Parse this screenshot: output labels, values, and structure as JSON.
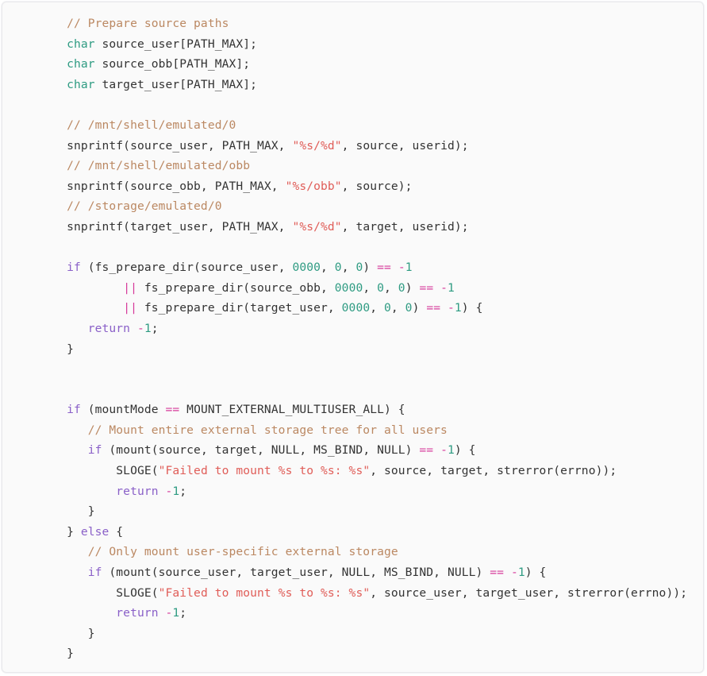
{
  "code_block": {
    "language": "c",
    "theme": {
      "background": "#fafafa",
      "border": "#e9e9ec",
      "plain": "#333333",
      "comment": "#bb8862",
      "type_keyword": "#2e9b82",
      "control_keyword": "#8a60c8",
      "string": "#e05d58",
      "number": "#2e9b82",
      "operator": "#d6399a"
    },
    "lines": [
      {
        "id": 1,
        "indent": 8,
        "tokens": [
          {
            "t": "com",
            "v": "// Prepare source paths"
          }
        ]
      },
      {
        "id": 2,
        "indent": 8,
        "tokens": [
          {
            "t": "typ",
            "v": "char"
          },
          {
            "t": "pln",
            "v": " source_user[PATH_MAX];"
          }
        ]
      },
      {
        "id": 3,
        "indent": 8,
        "tokens": [
          {
            "t": "typ",
            "v": "char"
          },
          {
            "t": "pln",
            "v": " source_obb[PATH_MAX];"
          }
        ]
      },
      {
        "id": 4,
        "indent": 8,
        "tokens": [
          {
            "t": "typ",
            "v": "char"
          },
          {
            "t": "pln",
            "v": " target_user[PATH_MAX];"
          }
        ]
      },
      {
        "id": 5,
        "indent": 0,
        "tokens": []
      },
      {
        "id": 6,
        "indent": 8,
        "tokens": [
          {
            "t": "com",
            "v": "// /mnt/shell/emulated/0"
          }
        ]
      },
      {
        "id": 7,
        "indent": 8,
        "tokens": [
          {
            "t": "pln",
            "v": "snprintf(source_user, PATH_MAX, "
          },
          {
            "t": "str",
            "v": "\"%s/%d\""
          },
          {
            "t": "pln",
            "v": ", source, userid);"
          }
        ]
      },
      {
        "id": 8,
        "indent": 8,
        "tokens": [
          {
            "t": "com",
            "v": "// /mnt/shell/emulated/obb"
          }
        ]
      },
      {
        "id": 9,
        "indent": 8,
        "tokens": [
          {
            "t": "pln",
            "v": "snprintf(source_obb, PATH_MAX, "
          },
          {
            "t": "str",
            "v": "\"%s/obb\""
          },
          {
            "t": "pln",
            "v": ", source);"
          }
        ]
      },
      {
        "id": 10,
        "indent": 8,
        "tokens": [
          {
            "t": "com",
            "v": "// /storage/emulated/0"
          }
        ]
      },
      {
        "id": 11,
        "indent": 8,
        "tokens": [
          {
            "t": "pln",
            "v": "snprintf(target_user, PATH_MAX, "
          },
          {
            "t": "str",
            "v": "\"%s/%d\""
          },
          {
            "t": "pln",
            "v": ", target, userid);"
          }
        ]
      },
      {
        "id": 12,
        "indent": 0,
        "tokens": []
      },
      {
        "id": 13,
        "indent": 8,
        "tokens": [
          {
            "t": "kw",
            "v": "if"
          },
          {
            "t": "pln",
            "v": " (fs_prepare_dir(source_user, "
          },
          {
            "t": "num",
            "v": "0000"
          },
          {
            "t": "pln",
            "v": ", "
          },
          {
            "t": "num",
            "v": "0"
          },
          {
            "t": "pln",
            "v": ", "
          },
          {
            "t": "num",
            "v": "0"
          },
          {
            "t": "pln",
            "v": ") "
          },
          {
            "t": "op",
            "v": "=="
          },
          {
            "t": "pln",
            "v": " "
          },
          {
            "t": "op",
            "v": "-"
          },
          {
            "t": "num",
            "v": "1"
          }
        ]
      },
      {
        "id": 14,
        "indent": 16,
        "tokens": [
          {
            "t": "op",
            "v": "||"
          },
          {
            "t": "pln",
            "v": " fs_prepare_dir(source_obb, "
          },
          {
            "t": "num",
            "v": "0000"
          },
          {
            "t": "pln",
            "v": ", "
          },
          {
            "t": "num",
            "v": "0"
          },
          {
            "t": "pln",
            "v": ", "
          },
          {
            "t": "num",
            "v": "0"
          },
          {
            "t": "pln",
            "v": ") "
          },
          {
            "t": "op",
            "v": "=="
          },
          {
            "t": "pln",
            "v": " "
          },
          {
            "t": "op",
            "v": "-"
          },
          {
            "t": "num",
            "v": "1"
          }
        ]
      },
      {
        "id": 15,
        "indent": 16,
        "tokens": [
          {
            "t": "op",
            "v": "||"
          },
          {
            "t": "pln",
            "v": " fs_prepare_dir(target_user, "
          },
          {
            "t": "num",
            "v": "0000"
          },
          {
            "t": "pln",
            "v": ", "
          },
          {
            "t": "num",
            "v": "0"
          },
          {
            "t": "pln",
            "v": ", "
          },
          {
            "t": "num",
            "v": "0"
          },
          {
            "t": "pln",
            "v": ") "
          },
          {
            "t": "op",
            "v": "=="
          },
          {
            "t": "pln",
            "v": " "
          },
          {
            "t": "op",
            "v": "-"
          },
          {
            "t": "num",
            "v": "1"
          },
          {
            "t": "pln",
            "v": ") {"
          }
        ]
      },
      {
        "id": 16,
        "indent": 11,
        "tokens": [
          {
            "t": "kw",
            "v": "return"
          },
          {
            "t": "pln",
            "v": " "
          },
          {
            "t": "op",
            "v": "-"
          },
          {
            "t": "num",
            "v": "1"
          },
          {
            "t": "pln",
            "v": ";"
          }
        ]
      },
      {
        "id": 17,
        "indent": 8,
        "tokens": [
          {
            "t": "pln",
            "v": "}"
          }
        ]
      },
      {
        "id": 18,
        "indent": 0,
        "tokens": []
      },
      {
        "id": 19,
        "indent": 0,
        "tokens": []
      },
      {
        "id": 20,
        "indent": 8,
        "tokens": [
          {
            "t": "kw",
            "v": "if"
          },
          {
            "t": "pln",
            "v": " (mountMode "
          },
          {
            "t": "op",
            "v": "=="
          },
          {
            "t": "pln",
            "v": " MOUNT_EXTERNAL_MULTIUSER_ALL) {"
          }
        ]
      },
      {
        "id": 21,
        "indent": 11,
        "tokens": [
          {
            "t": "com",
            "v": "// Mount entire external storage tree for all users"
          }
        ]
      },
      {
        "id": 22,
        "indent": 11,
        "tokens": [
          {
            "t": "kw",
            "v": "if"
          },
          {
            "t": "pln",
            "v": " (mount(source, target, NULL, MS_BIND, NULL) "
          },
          {
            "t": "op",
            "v": "=="
          },
          {
            "t": "pln",
            "v": " "
          },
          {
            "t": "op",
            "v": "-"
          },
          {
            "t": "num",
            "v": "1"
          },
          {
            "t": "pln",
            "v": ") {"
          }
        ]
      },
      {
        "id": 23,
        "indent": 15,
        "tokens": [
          {
            "t": "pln",
            "v": "SLOGE("
          },
          {
            "t": "str",
            "v": "\"Failed to mount %s to %s: %s\""
          },
          {
            "t": "pln",
            "v": ", source, target, strerror(errno));"
          }
        ]
      },
      {
        "id": 24,
        "indent": 15,
        "tokens": [
          {
            "t": "kw",
            "v": "return"
          },
          {
            "t": "pln",
            "v": " "
          },
          {
            "t": "op",
            "v": "-"
          },
          {
            "t": "num",
            "v": "1"
          },
          {
            "t": "pln",
            "v": ";"
          }
        ]
      },
      {
        "id": 25,
        "indent": 11,
        "tokens": [
          {
            "t": "pln",
            "v": "}"
          }
        ]
      },
      {
        "id": 26,
        "indent": 8,
        "tokens": [
          {
            "t": "pln",
            "v": "} "
          },
          {
            "t": "kw",
            "v": "else"
          },
          {
            "t": "pln",
            "v": " {"
          }
        ]
      },
      {
        "id": 27,
        "indent": 11,
        "tokens": [
          {
            "t": "com",
            "v": "// Only mount user-specific external storage"
          }
        ]
      },
      {
        "id": 28,
        "indent": 11,
        "tokens": [
          {
            "t": "kw",
            "v": "if"
          },
          {
            "t": "pln",
            "v": " (mount(source_user, target_user, NULL, MS_BIND, NULL) "
          },
          {
            "t": "op",
            "v": "=="
          },
          {
            "t": "pln",
            "v": " "
          },
          {
            "t": "op",
            "v": "-"
          },
          {
            "t": "num",
            "v": "1"
          },
          {
            "t": "pln",
            "v": ") {"
          }
        ]
      },
      {
        "id": 29,
        "indent": 15,
        "tokens": [
          {
            "t": "pln",
            "v": "SLOGE("
          },
          {
            "t": "str",
            "v": "\"Failed to mount %s to %s: %s\""
          },
          {
            "t": "pln",
            "v": ", source_user, target_user, strerror(errno));"
          }
        ]
      },
      {
        "id": 30,
        "indent": 15,
        "tokens": [
          {
            "t": "kw",
            "v": "return"
          },
          {
            "t": "pln",
            "v": " "
          },
          {
            "t": "op",
            "v": "-"
          },
          {
            "t": "num",
            "v": "1"
          },
          {
            "t": "pln",
            "v": ";"
          }
        ]
      },
      {
        "id": 31,
        "indent": 11,
        "tokens": [
          {
            "t": "pln",
            "v": "}"
          }
        ]
      },
      {
        "id": 32,
        "indent": 8,
        "tokens": [
          {
            "t": "pln",
            "v": "}"
          }
        ]
      }
    ]
  }
}
